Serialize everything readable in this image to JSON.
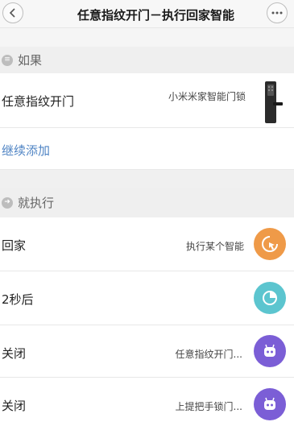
{
  "header": {
    "title": "任意指纹开门－执行回家智能",
    "back_icon": "chevron-left-icon",
    "more_icon": "ellipsis-icon"
  },
  "if_section": {
    "label": "如果",
    "icon": "list-icon",
    "condition": {
      "label": "任意指纹开门",
      "device": "小米米家智能门锁",
      "image": "door-lock-image"
    },
    "add_more": "继续添加"
  },
  "then_section": {
    "label": "就执行",
    "icon": "arrow-right-icon",
    "actions": [
      {
        "label": "回家",
        "value": "执行某个智能",
        "icon": "cursor-click-icon",
        "color": "#ef9a48"
      },
      {
        "label": "2秒后",
        "value": "",
        "icon": "clock-icon",
        "color": "#5cc5cf"
      },
      {
        "label": "关闭",
        "value": "任意指纹开门...",
        "icon": "robot-icon",
        "color": "#7b5ed6"
      },
      {
        "label": "关闭",
        "value": "上提把手锁门...",
        "icon": "robot-icon",
        "color": "#7b5ed6"
      }
    ]
  }
}
